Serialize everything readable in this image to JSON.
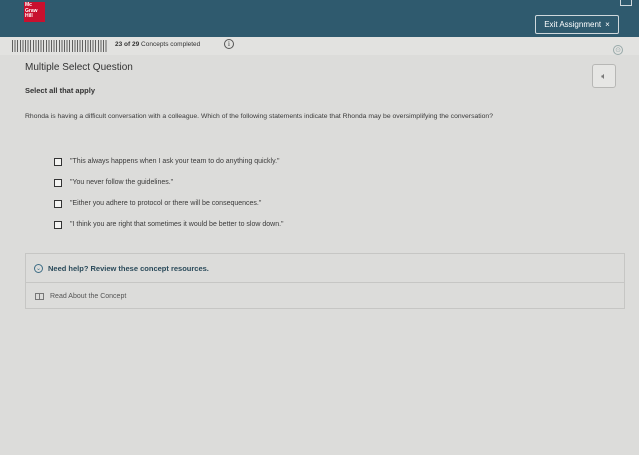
{
  "header": {
    "logo_lines": [
      "Mc",
      "Graw",
      "Hill"
    ],
    "exit_label": "Exit Assignment",
    "exit_icon": "×"
  },
  "progress": {
    "completed": 23,
    "total": 29,
    "count_text": "23 of 29",
    "label": "Concepts completed",
    "info_icon": "i"
  },
  "question": {
    "type_label": "Multiple Select Question",
    "instruction": "Select all that apply",
    "prompt": "Rhonda is having a difficult conversation with a colleague. Which of the following statements indicate that Rhonda may be oversimplifying the conversation?",
    "options": [
      "\"This always happens when I ask your team to do anything quickly.\"",
      "\"You never follow the guidelines.\"",
      "\"Either you adhere to protocol or there will be consequences.\"",
      "\"I think you are right that sometimes it would be better to slow down.\""
    ]
  },
  "help": {
    "title": "Need help? Review these concept resources.",
    "link": "Read About the Concept"
  }
}
